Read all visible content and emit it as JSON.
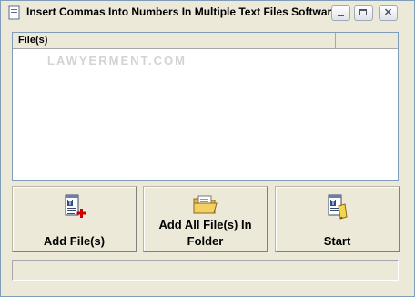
{
  "window": {
    "title": "Insert Commas Into Numbers In Multiple Text Files Software",
    "close_glyph": "✕"
  },
  "files_list": {
    "column_header": "File(s)",
    "watermark": "LAWYERMENT.COM"
  },
  "buttons": {
    "add_files": "Add File(s)",
    "add_folder_line1": "Add All File(s) In",
    "add_folder_line2": "Folder",
    "start": "Start"
  },
  "icons": {
    "app": "app-icon",
    "add_files": "text-file-plus-icon",
    "add_folder": "folder-icon",
    "start": "text-file-pencil-icon"
  },
  "colors": {
    "title_text": "#000000",
    "window_bg": "#ece9d8",
    "list_bg": "#ffffff",
    "watermark": "#d3d3d3",
    "plus_red": "#cc0000"
  },
  "status": {
    "text": ""
  }
}
